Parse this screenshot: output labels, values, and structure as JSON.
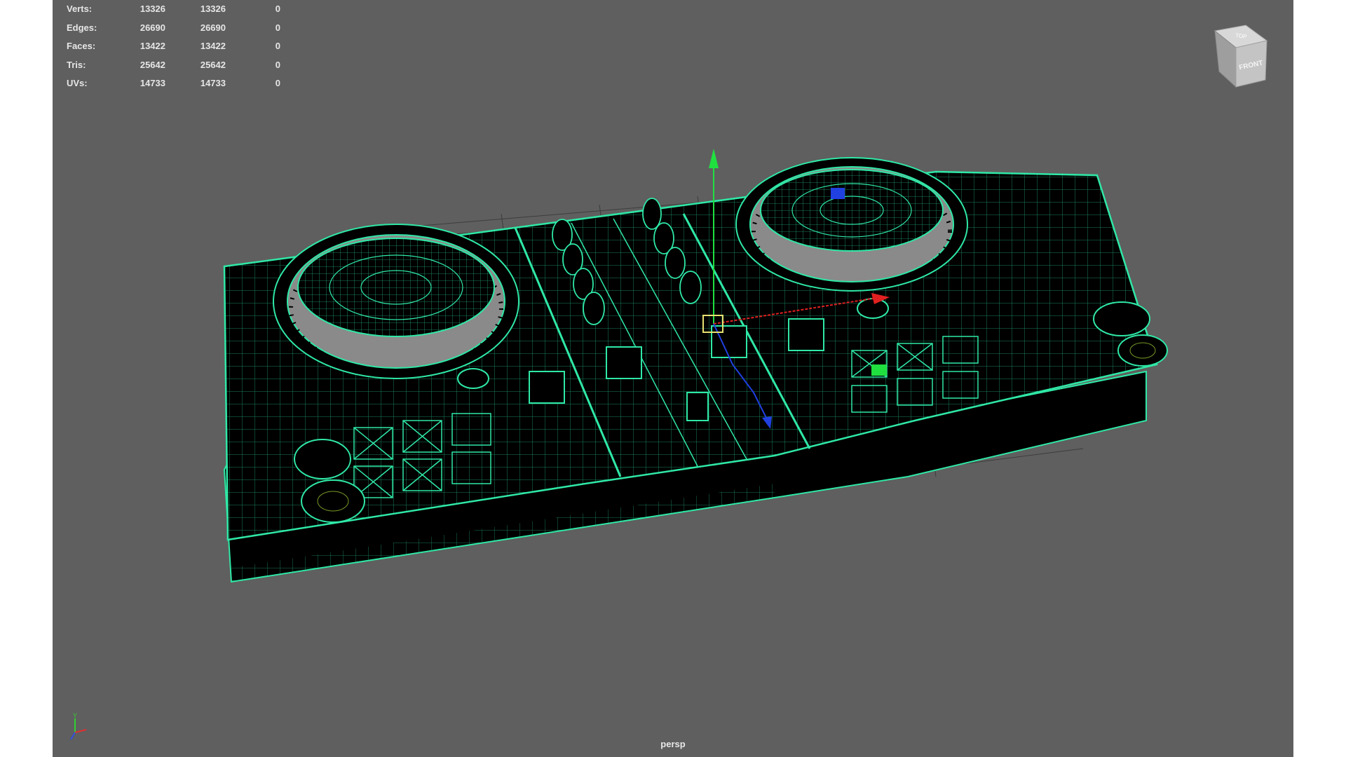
{
  "app": "Autodesk Maya",
  "viewport": {
    "camera": "persp",
    "background": "#5f5f5f",
    "wireframe_color": "#2fe8a6",
    "shaded_face_color": "#000000"
  },
  "heads_up": {
    "rows": [
      {
        "label": "Verts:",
        "v1": "13326",
        "v2": "13326",
        "v3": "0"
      },
      {
        "label": "Edges:",
        "v1": "26690",
        "v2": "26690",
        "v3": "0"
      },
      {
        "label": "Faces:",
        "v1": "13422",
        "v2": "13422",
        "v3": "0"
      },
      {
        "label": "Tris:",
        "v1": "25642",
        "v2": "25642",
        "v3": "0"
      },
      {
        "label": "UVs:",
        "v1": "14733",
        "v2": "14733",
        "v3": "0"
      }
    ]
  },
  "viewcube": {
    "front_label": "FRONT",
    "top_label": "TOP"
  },
  "axis_indicator": {
    "y_label": "Y",
    "x_color": "#e03030",
    "y_color": "#30d030",
    "z_color": "#3050e0"
  },
  "manipulator": {
    "x_color": "#e02020",
    "y_color": "#20e040",
    "z_color": "#2040e0",
    "center_color": "#e8e070"
  }
}
